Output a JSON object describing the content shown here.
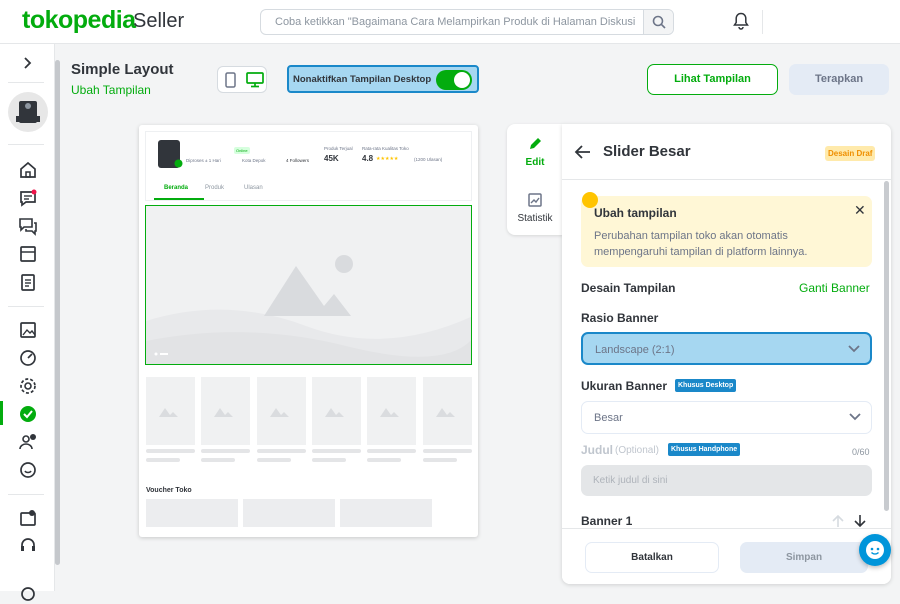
{
  "header": {
    "logo": "tokopedia",
    "logo_suffix": "Seller",
    "search_placeholder": "Coba ketikkan \"Bagaimana Cara Melampirkan Produk di Halaman Diskusi\"",
    "icons": [
      "search-icon",
      "bell-icon"
    ]
  },
  "sidebar": {
    "icons": [
      "chevron-right-icon",
      "home-icon",
      "chat-icon",
      "discussion-icon",
      "store-icon",
      "order-list-icon",
      "product-image-icon",
      "statistics-icon",
      "gear-icon",
      "verified-badge-icon",
      "user-chat-icon",
      "support-icon",
      "store-decoration-icon",
      "customer-service-icon",
      "settings-icon"
    ]
  },
  "page": {
    "title": "Simple Layout",
    "subtitle": "Ubah Tampilan",
    "disable_desktop_label": "Nonaktifkan Tampilan Desktop",
    "view_button": "Lihat Tampilan",
    "apply_button": "Terapkan"
  },
  "preview": {
    "online_badge": "Online",
    "reply_time": "Diproses ± 1 Hari",
    "location": "Kota Depok",
    "followers": "4 Followers",
    "sold_label": "Produk Terjual",
    "sold_value": "45K",
    "rating_label": "Rata-rata Kualitas Toko",
    "rating_value": "4.8",
    "rating_stars": "★★★★★",
    "rating_count": "(1200 Ulasan)",
    "tabs": [
      "Beranda",
      "Produk",
      "Ulasan"
    ],
    "voucher_title": "Voucher Toko"
  },
  "side_tabs": {
    "edit": "Edit",
    "stats": "Statistik"
  },
  "panel": {
    "title": "Slider Besar",
    "draft_badge": "Desain Draf",
    "notice_title": "Ubah tampilan",
    "notice_text": "Perubahan tampilan toko akan otomatis mempengaruhi tampilan di platform lainnya.",
    "design_label": "Desain Tampilan",
    "change_banner": "Ganti Banner",
    "ratio_label": "Rasio Banner",
    "ratio_value": "Landscape (2:1)",
    "size_label": "Ukuran Banner",
    "desktop_only": "Khusus Desktop",
    "size_value": "Besar",
    "heading_label": "Judul",
    "optional": "(Optional)",
    "phone_only": "Khusus Handphone",
    "heading_counter": "0/60",
    "heading_placeholder": "Ketik judul di sini",
    "banner1_label": "Banner 1",
    "cancel_button": "Batalkan",
    "save_button": "Simpan"
  },
  "colors": {
    "brand_green": "#03ac0e",
    "highlight_blue": "#1a88c9",
    "highlight_fill": "#a6d7f1"
  }
}
